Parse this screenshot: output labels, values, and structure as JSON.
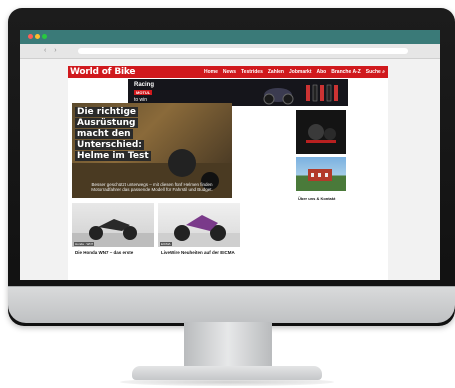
{
  "site": {
    "logo": "World of Bike",
    "nav": [
      "Home",
      "News",
      "Testrides",
      "Zahlen",
      "Jobmarkt",
      "Abo",
      "Branche A-Z",
      "Suche"
    ],
    "accent_color": "#d0191d"
  },
  "banner": {
    "title": "Racing",
    "badge": "MOTUL",
    "subtitle": "to win"
  },
  "hero": {
    "title_lines": [
      "Die richtige Ausrüstung",
      "macht den Unterschied:",
      "Helme im Test"
    ],
    "caption": "Besser geschützt unterwegs – mit diesen fünf Helmen finden Motorradfahrer das passende Modell für Fahrstil und Budget."
  },
  "cards": [
    {
      "tag": "Honda · WN7",
      "title": "Die Honda WN7 – das erste"
    },
    {
      "tag": "EICMA",
      "title": "LiveWire Neuheiten auf der EICMA"
    }
  ],
  "about": {
    "title": "Über uns & Kontakt"
  }
}
